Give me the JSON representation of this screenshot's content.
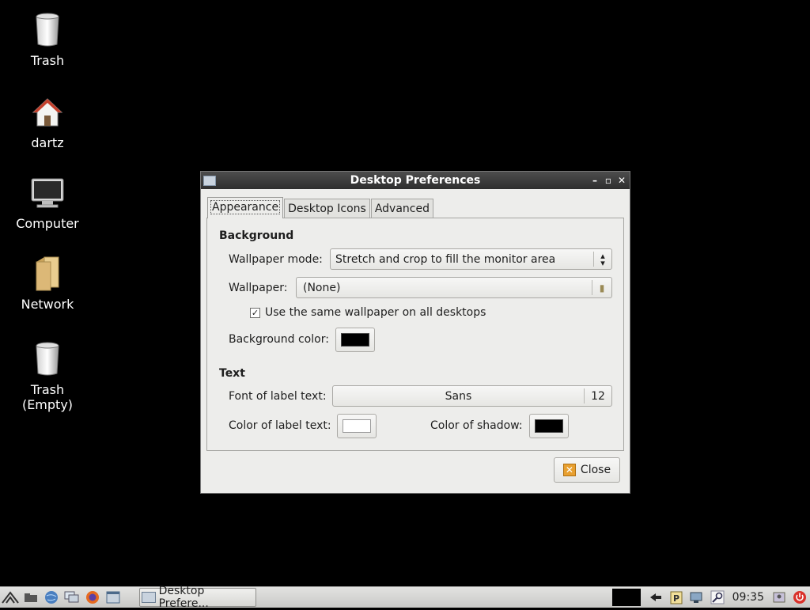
{
  "desktop": {
    "icons": [
      {
        "label": "Trash",
        "icon": "trash-icon"
      },
      {
        "label": "dartz",
        "icon": "home-folder-icon"
      },
      {
        "label": "Computer",
        "icon": "computer-icon"
      },
      {
        "label": "Network",
        "icon": "network-folder-icon"
      },
      {
        "label": "Trash\n(Empty)",
        "icon": "trash-empty-icon"
      }
    ]
  },
  "window": {
    "title": "Desktop Preferences",
    "tabs": [
      {
        "label": "Appearance"
      },
      {
        "label": "Desktop Icons"
      },
      {
        "label": "Advanced"
      }
    ],
    "background": {
      "heading": "Background",
      "wallpaper_mode_label": "Wallpaper mode:",
      "wallpaper_mode_value": "Stretch and crop to fill the monitor area",
      "wallpaper_label": "Wallpaper:",
      "wallpaper_value": "(None)",
      "same_wallpaper_label": "Use the same wallpaper on all desktops",
      "same_wallpaper_checked": true,
      "bg_color_label": "Background color:",
      "bg_color": "#000000"
    },
    "text": {
      "heading": "Text",
      "font_label": "Font of label text:",
      "font_name": "Sans",
      "font_size": "12",
      "label_color_label": "Color of label text:",
      "label_color": "#ffffff",
      "shadow_color_label": "Color of shadow:",
      "shadow_color": "#000000"
    },
    "close_label": "Close"
  },
  "taskbar": {
    "task_label": "Desktop Prefere...",
    "clock": "09:35"
  },
  "colors": {
    "desktop_bg": "#000000",
    "titlebar": "#3a3a3a",
    "window_bg": "#ededeb"
  }
}
